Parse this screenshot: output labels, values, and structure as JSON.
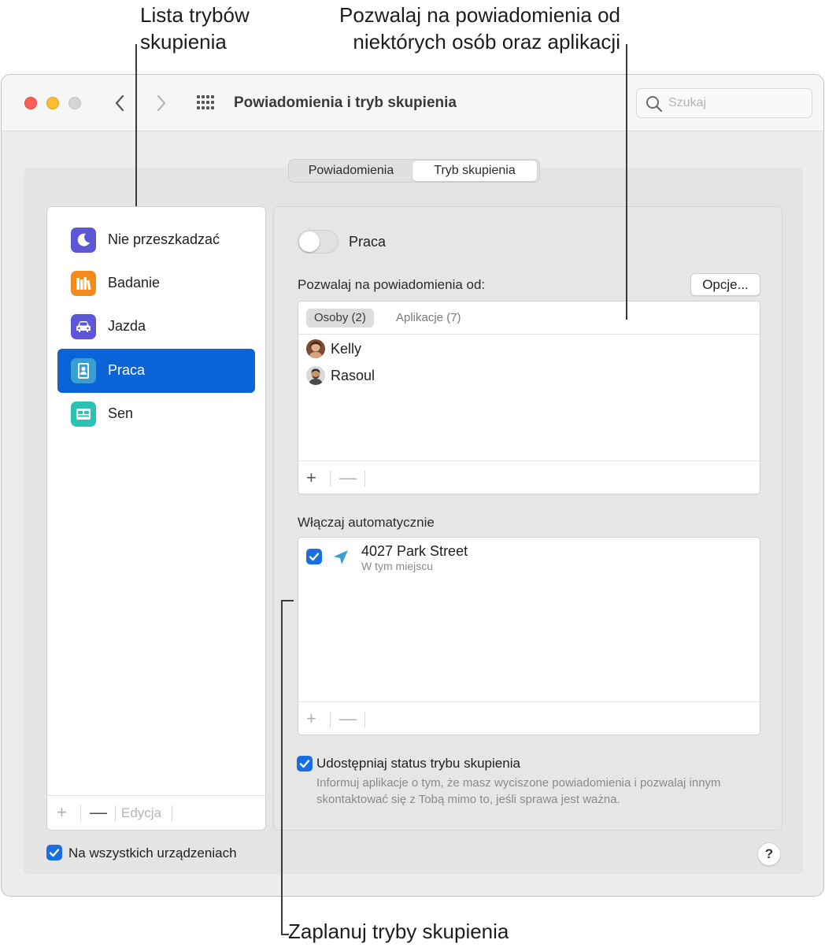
{
  "callouts": {
    "modes_list_line1": "Lista trybów",
    "modes_list_line2": "skupienia",
    "allow_line1": "Pozwalaj na powiadomienia od",
    "allow_line2": "niektórych osób oraz aplikacji",
    "schedule": "Zaplanuj tryby skupienia"
  },
  "window": {
    "title": "Powiadomienia i tryb skupienia",
    "search_placeholder": "Szukaj"
  },
  "tabs": [
    {
      "label": "Powiadomienia",
      "selected": false
    },
    {
      "label": "Tryb skupienia",
      "selected": true
    }
  ],
  "sidebar": {
    "modes": [
      {
        "label": "Nie przeszkadzać",
        "icon": "moon-icon",
        "color": "#5b57d6",
        "selected": false
      },
      {
        "label": "Badanie",
        "icon": "books-icon",
        "color": "#f28a1e",
        "selected": false
      },
      {
        "label": "Jazda",
        "icon": "car-icon",
        "color": "#5b57d6",
        "selected": false
      },
      {
        "label": "Praca",
        "icon": "badge-icon",
        "color": "#3a9ed0",
        "selected": true
      },
      {
        "label": "Sen",
        "icon": "bed-icon",
        "color": "#2cc1b4",
        "selected": false
      }
    ],
    "footer": {
      "add": "+",
      "remove": "—",
      "edit": "Edycja"
    }
  },
  "pane": {
    "mode_name": "Praca",
    "allow_label": "Pozwalaj na powiadomienia od:",
    "options_button": "Opcje...",
    "allow_tabs": [
      {
        "label": "Osoby (2)",
        "active": true
      },
      {
        "label": "Aplikacje (7)",
        "active": false
      }
    ],
    "people": [
      {
        "name": "Kelly"
      },
      {
        "name": "Rasoul"
      }
    ],
    "list_footer": {
      "add": "+",
      "remove": "—"
    },
    "auto_label": "Włączaj automatycznie",
    "automation": {
      "title": "4027 Park Street",
      "subtitle": "W tym miejscu",
      "checked": true
    },
    "share": {
      "label": "Udostępniaj status trybu skupienia",
      "description": "Informuj aplikacje o tym, że masz wyciszone powiadomienia i pozwalaj innym skontaktować się z Tobą mimo to, jeśli sprawa jest ważna.",
      "checked": true
    }
  },
  "all_devices": {
    "label": "Na wszystkich urządzeniach",
    "checked": true
  },
  "help_label": "?",
  "accent_color": "#0a64d8"
}
